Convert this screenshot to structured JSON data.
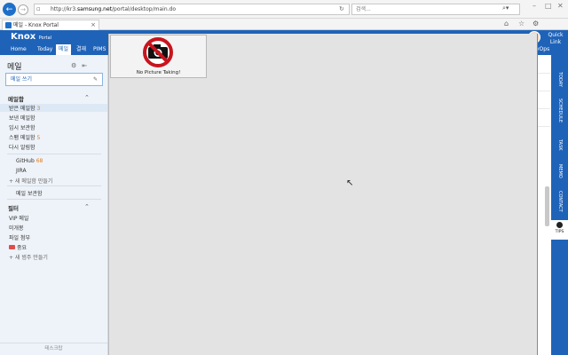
{
  "browser": {
    "url_prefix": "http://kr3.",
    "url_host": "samsung.net",
    "url_path": "/portal/desktop/main.do",
    "search_placeholder": "검색...",
    "tab_title": "메일 - Knox Portal"
  },
  "header": {
    "logo": "Knox",
    "logo_sub": "Portal",
    "menu": [
      "Home",
      "Today",
      "메일",
      "결재",
      "PIMS"
    ],
    "active_menu": "메일",
    "right_menu": "vOps",
    "quick_link": [
      "Quick",
      "Link"
    ]
  },
  "sidebar": {
    "title": "메일",
    "compose": "메일 쓰기",
    "mailbox_heading": "메일함",
    "mailboxes": [
      {
        "label": "받은 메일함",
        "count": "3"
      },
      {
        "label": "보낸 메일함",
        "count": ""
      },
      {
        "label": "임시 보관함",
        "count": ""
      },
      {
        "label": "스팸 메일함",
        "count": "5"
      },
      {
        "label": "다시 알림함",
        "count": ""
      }
    ],
    "folders": [
      {
        "label": "GitHub",
        "count": "68"
      },
      {
        "label": "JIRA",
        "count": ""
      }
    ],
    "new_mailbox": "+ 새 메일함 만들기",
    "archive": "메일 보관함",
    "filter_heading": "필터",
    "filters": [
      "VIP 메일",
      "미개봉",
      "파일 첨부",
      "중요"
    ],
    "new_category": "+ 새 범주 만들기",
    "footer": "테스크탑"
  },
  "viewer": {
    "thumb_caption": "No Picture Taking!"
  },
  "rail": {
    "items": [
      "TODAY",
      "SCHEDULE",
      "TASK",
      "MEMO",
      "CONTACT"
    ],
    "tips": "TIPS"
  },
  "colors": {
    "brand": "#1f63b9",
    "accent_count": "#e87a1a"
  }
}
